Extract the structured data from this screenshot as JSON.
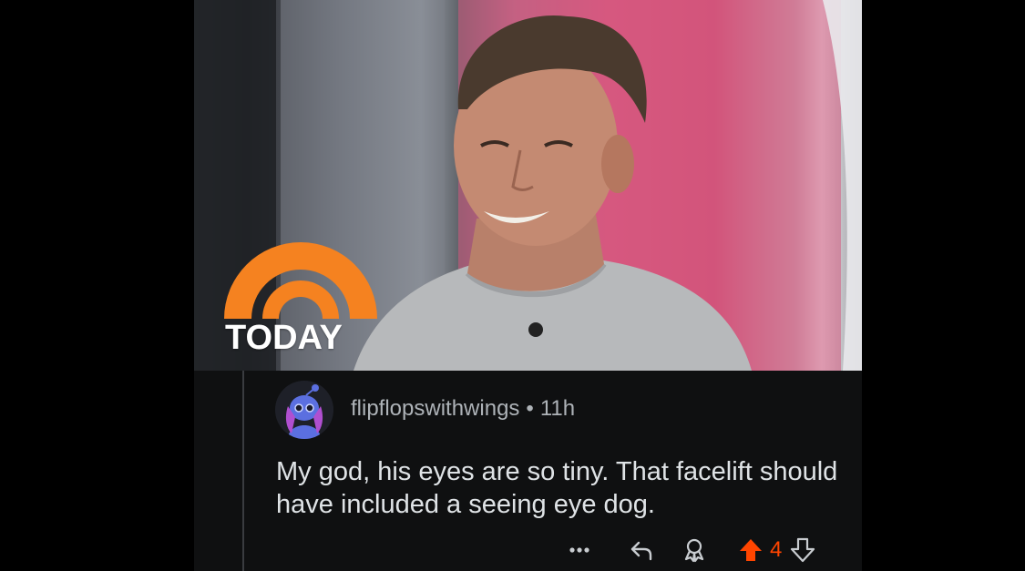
{
  "photo": {
    "logo_text": "TODAY"
  },
  "comment": {
    "username": "flipflopswithwings",
    "separator": "•",
    "timestamp": "11h",
    "body": "My god, his eyes are so tiny. That facelift should have included a seeing eye dog.",
    "actions": {
      "more_icon": "more-horizontal-icon",
      "reply_icon": "reply-arrow-icon",
      "award_icon": "award-icon",
      "upvote_icon": "upvote-arrow-icon",
      "downvote_icon": "downvote-arrow-icon",
      "vote_count": "4"
    }
  },
  "colors": {
    "background": "#000000",
    "post_background": "#0f1011",
    "upvote_active": "#ff4500",
    "today_orange": "#f58220",
    "text_primary": "#dfe3e6",
    "text_meta": "#aeb3b8"
  }
}
